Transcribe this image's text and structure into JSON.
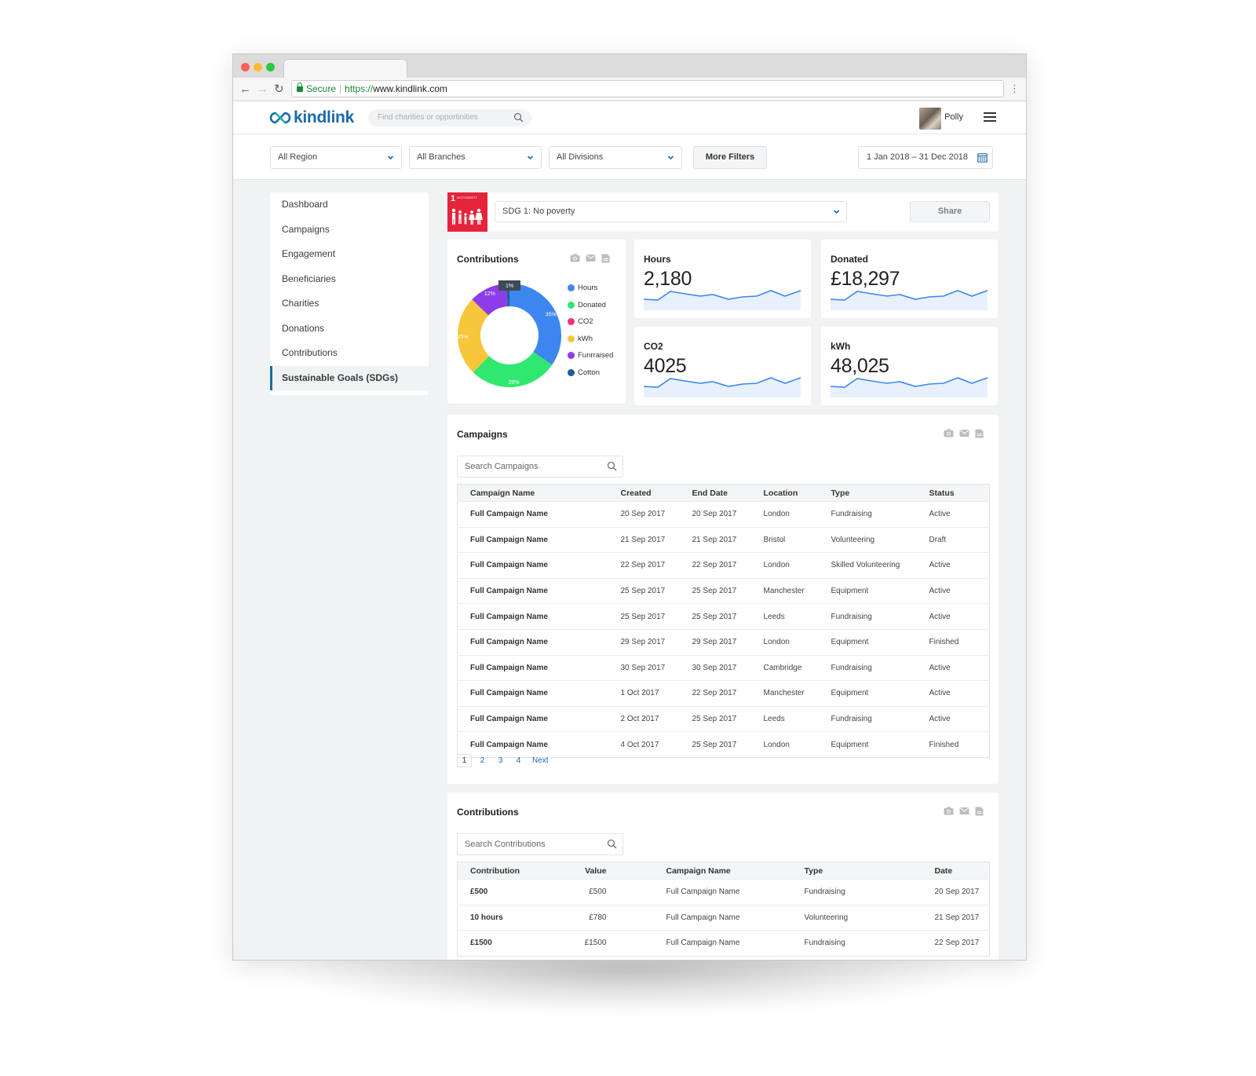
{
  "browser": {
    "secure_label": "Secure",
    "url_scheme": "https://",
    "url_host": "www.kindlink.com"
  },
  "header": {
    "logo_text": "kindlink",
    "search_placeholder": "Find charities or opportinities",
    "user_name": "Polly"
  },
  "filters": {
    "region": "All Region",
    "branches": "All Branches",
    "divisions": "All Divisions",
    "more_filters": "More Filters",
    "date_range": "1 Jan 2018 – 31 Dec 2018"
  },
  "sidebar": {
    "items": [
      {
        "label": "Dashboard"
      },
      {
        "label": "Campaigns"
      },
      {
        "label": "Engagement"
      },
      {
        "label": "Beneficiaries"
      },
      {
        "label": "Charities"
      },
      {
        "label": "Donations"
      },
      {
        "label": "Contributions"
      },
      {
        "label": "Sustainable Goals (SDGs)"
      }
    ],
    "active_index": 7
  },
  "sdg": {
    "tile_number": "1",
    "tile_label": "NO POVERTY",
    "tile_color": "#e5243b",
    "selected": "SDG 1: No poverty",
    "share_label": "Share"
  },
  "contributions_chart": {
    "title": "Contributions"
  },
  "chart_data": {
    "type": "pie",
    "variant": "donut",
    "labels": [
      "Hours",
      "Donated",
      "CO2",
      "kWh",
      "Funrraised",
      "Cotton"
    ],
    "values": [
      35,
      28,
      0,
      25,
      12,
      1
    ],
    "slice_labels": [
      "35%",
      "28%",
      "",
      "25%",
      "12%",
      "1%"
    ],
    "colors": [
      "#3d86f0",
      "#2ee870",
      "#f0306f",
      "#f8c63a",
      "#8c3ce8",
      "#1f5d96"
    ],
    "legend_position": "right"
  },
  "stats": {
    "hours": {
      "label": "Hours",
      "value": "2,180"
    },
    "donated": {
      "label": "Donated",
      "value": "£18,297"
    },
    "co2": {
      "label": "CO2",
      "value": "4025"
    },
    "kwh": {
      "label": "kWh",
      "value": "48,025"
    }
  },
  "campaigns": {
    "title": "Campaigns",
    "search_placeholder": "Search Campaigns",
    "columns": [
      "Campaign Name",
      "Created",
      "End Date",
      "Location",
      "Type",
      "Status"
    ],
    "rows": [
      [
        "Full Campaign Name",
        "20 Sep 2017",
        "20 Sep 2017",
        "London",
        "Fundraising",
        "Active"
      ],
      [
        "Full Campaign Name",
        "21 Sep 2017",
        "21 Sep 2017",
        "Bristol",
        "Volunteering",
        "Draft"
      ],
      [
        "Full Campaign Name",
        "22 Sep 2017",
        "22 Sep 2017",
        "London",
        "Skilled Volunteering",
        "Active"
      ],
      [
        "Full Campaign Name",
        "25 Sep 2017",
        "25 Sep 2017",
        "Manchester",
        "Equipment",
        "Active"
      ],
      [
        "Full Campaign Name",
        "25 Sep 2017",
        "25 Sep 2017",
        "Leeds",
        "Fundraising",
        "Active"
      ],
      [
        "Full Campaign Name",
        "29 Sep 2017",
        "29 Sep 2017",
        "London",
        "Equipment",
        "Finished"
      ],
      [
        "Full Campaign Name",
        "30 Sep 2017",
        "30 Sep 2017",
        "Cambridge",
        "Fundraising",
        "Active"
      ],
      [
        "Full Campaign Name",
        "1 Oct 2017",
        "22 Sep 2017",
        "Manchester",
        "Equipment",
        "Active"
      ],
      [
        "Full Campaign Name",
        "2 Oct 2017",
        "25 Sep 2017",
        "Leeds",
        "Fundraising",
        "Active"
      ],
      [
        "Full Campaign Name",
        "4 Oct 2017",
        "25 Sep 2017",
        "London",
        "Equipment",
        "Finished"
      ]
    ],
    "pagination": {
      "pages": [
        "1",
        "2",
        "3",
        "4"
      ],
      "current": "1",
      "next_label": "Next"
    }
  },
  "contributions": {
    "title": "Contributions",
    "search_placeholder": "Search Contributions",
    "columns": [
      "Contribution",
      "Value",
      "Campaign Name",
      "Type",
      "Date"
    ],
    "rows": [
      [
        "£500",
        "£500",
        "Full Campaign Name",
        "Fundraising",
        "20 Sep 2017"
      ],
      [
        "10 hours",
        "£780",
        "Full Campaign Name",
        "Volunteering",
        "21 Sep 2017"
      ],
      [
        "£1500",
        "£1500",
        "Full Campaign Name",
        "Fundraising",
        "22 Sep 2017"
      ]
    ]
  }
}
